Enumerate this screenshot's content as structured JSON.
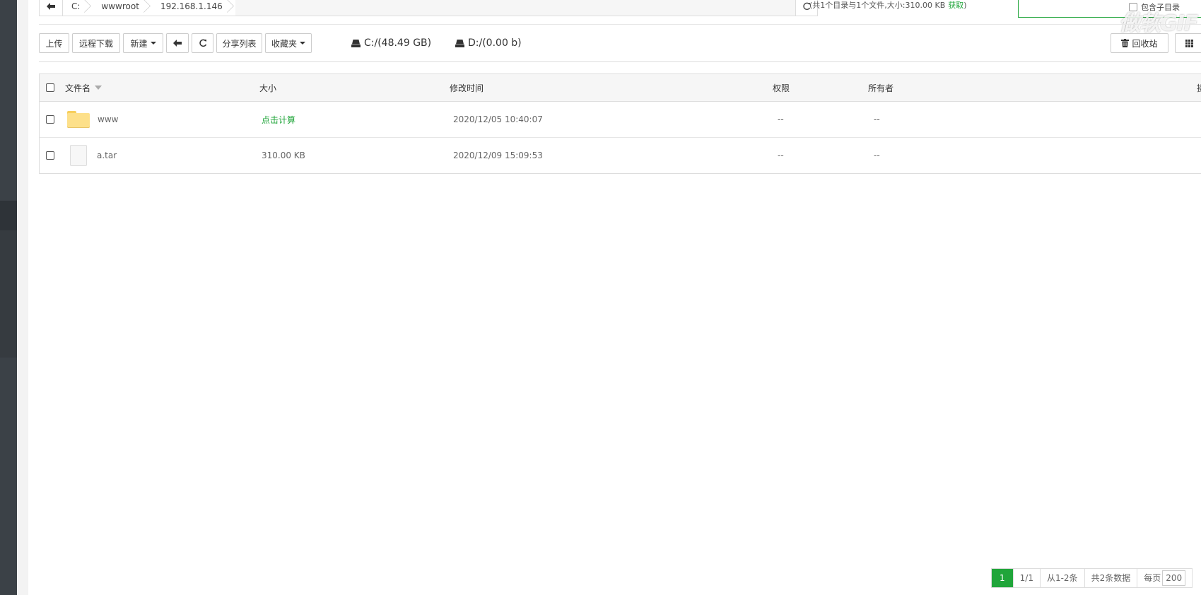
{
  "path": {
    "crumbs": [
      "C:",
      "wwwroot",
      "192.168.1.146"
    ]
  },
  "summary": {
    "text": "(共1个目录与1个文件,大小:310.00 KB",
    "link": "获取",
    "close": ")"
  },
  "search": {
    "include_subdirs_label": "包含子目录"
  },
  "watermark": "做软GIF",
  "toolbar": {
    "upload": "上传",
    "remote_download": "远程下载",
    "new": "新建",
    "share_list": "分享列表",
    "favorites": "收藏夹",
    "recycle_bin": "回收站"
  },
  "disks": [
    {
      "label": "C:/(48.49 GB)"
    },
    {
      "label": "D:/(0.00 b)"
    }
  ],
  "table": {
    "headers": {
      "name": "文件名",
      "size": "大小",
      "mtime": "修改时间",
      "perm": "权限",
      "owner": "所有者",
      "action": "操"
    },
    "rows": [
      {
        "name": "www",
        "type": "folder",
        "size": "点击计算",
        "mtime": "2020/12/05 10:40:07",
        "perm": "--",
        "owner": "--"
      },
      {
        "name": "a.tar",
        "type": "file",
        "size": "310.00 KB",
        "mtime": "2020/12/09 15:09:53",
        "perm": "--",
        "owner": "--"
      }
    ]
  },
  "pagination": {
    "current": "1",
    "pages": "1/1",
    "range": "从1-2条",
    "total": "共2条数据",
    "per_page_label": "每页",
    "per_page_value": "200"
  },
  "colors": {
    "accent": "#20a53a",
    "sidebar": "#3b4147"
  }
}
